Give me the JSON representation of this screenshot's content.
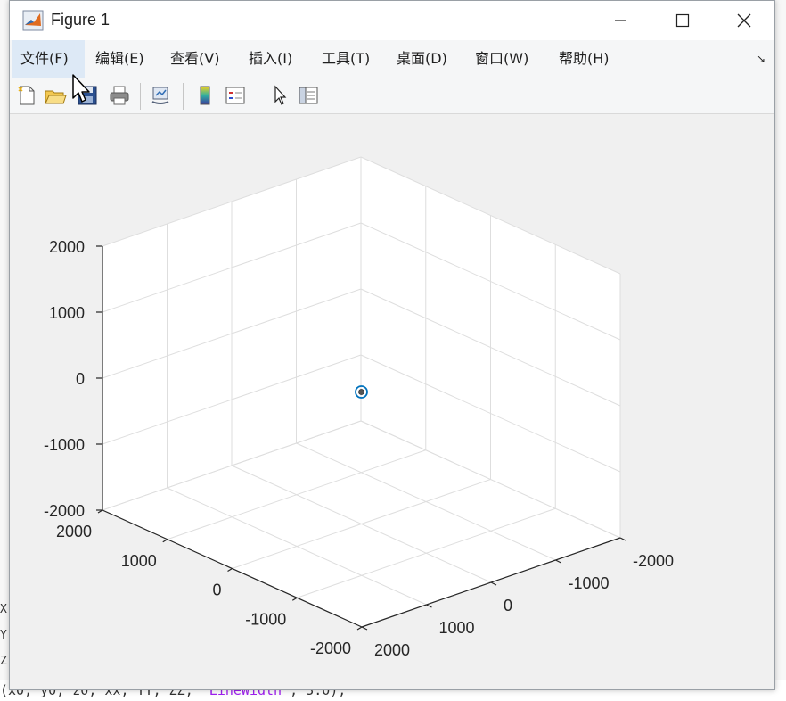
{
  "window": {
    "title": "Figure 1",
    "buttons": {
      "minimize": "minimize",
      "maximize": "maximize",
      "close": "close"
    }
  },
  "menu": {
    "items": [
      {
        "label": "文件(F)"
      },
      {
        "label": "编辑(E)"
      },
      {
        "label": "查看(V)"
      },
      {
        "label": "插入(I)"
      },
      {
        "label": "工具(T)"
      },
      {
        "label": "桌面(D)"
      },
      {
        "label": "窗口(W)"
      },
      {
        "label": "帮助(H)"
      }
    ],
    "overflow_icon": "↘"
  },
  "toolbar": {
    "icons": [
      "new-figure-icon",
      "open-file-icon",
      "save-icon",
      "print-icon",
      "link-plot-icon",
      "insert-colorbar-icon",
      "insert-legend-icon",
      "edit-plot-icon",
      "property-inspector-icon"
    ]
  },
  "chart_data": {
    "type": "scatter3d",
    "title": "",
    "xlabel": "",
    "ylabel": "",
    "zlabel": "",
    "xlim": [
      -2000,
      2000
    ],
    "ylim": [
      -2000,
      2000
    ],
    "zlim": [
      -2000,
      2000
    ],
    "x_ticks": [
      "-2000",
      "-1000",
      "0",
      "1000",
      "2000"
    ],
    "y_ticks": [
      "-2000",
      "-1000",
      "0",
      "1000",
      "2000"
    ],
    "z_ticks": [
      "-2000",
      "-1000",
      "0",
      "1000",
      "2000"
    ],
    "grid": true,
    "points": [
      {
        "x": 0,
        "y": 0,
        "z": 0,
        "marker": "circle",
        "color": "#0072bd"
      }
    ]
  },
  "background": {
    "code_line_start": "(x0, y0, z0, xx, YY, ZZ, ",
    "code_line_string": "'LineWidth'",
    "code_line_end": ", 3.0);",
    "fragments": [
      "X",
      "Y",
      "Z",
      "Y",
      "X"
    ]
  },
  "colors": {
    "marker": "#0072bd",
    "axes_line": "#262626",
    "grid": "#dedede",
    "menu_active": "#dde9f6"
  }
}
